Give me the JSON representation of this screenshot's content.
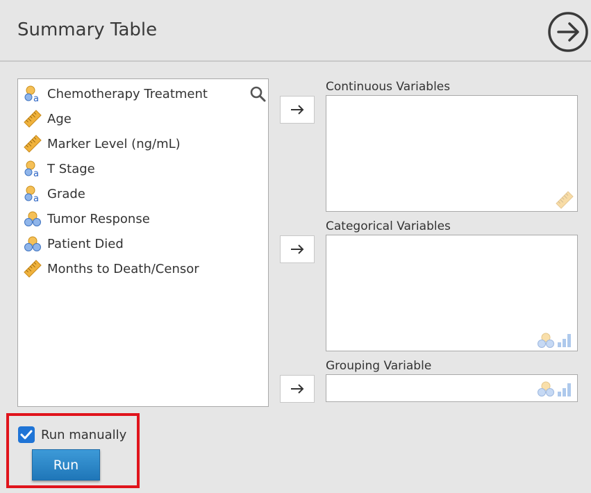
{
  "header": {
    "title": "Summary Table"
  },
  "variables": [
    {
      "label": "Chemotherapy Treatment",
      "type": "nominal-text"
    },
    {
      "label": "Age",
      "type": "continuous"
    },
    {
      "label": "Marker Level (ng/mL)",
      "type": "continuous"
    },
    {
      "label": "T Stage",
      "type": "nominal-text"
    },
    {
      "label": "Grade",
      "type": "nominal-text"
    },
    {
      "label": "Tumor Response",
      "type": "nominal"
    },
    {
      "label": "Patient Died",
      "type": "nominal"
    },
    {
      "label": "Months to Death/Censor",
      "type": "continuous"
    }
  ],
  "targets": {
    "continuous": {
      "label": "Continuous Variables"
    },
    "categorical": {
      "label": "Categorical Variables"
    },
    "grouping": {
      "label": "Grouping Variable"
    }
  },
  "run": {
    "checkbox_label": "Run manually",
    "checked": true,
    "button_label": "Run"
  },
  "colors": {
    "accent": "#1f74d6",
    "highlight": "#e0141c",
    "ruler": "#f0b23c",
    "nominal_blue": "#7aa6e0"
  },
  "icons": [
    "arrow-right-circle-icon",
    "search-icon",
    "ruler-icon",
    "nominal-icon",
    "nominal-text-icon",
    "arrow-right-icon",
    "bar-levels-icon",
    "checkmark-icon"
  ]
}
